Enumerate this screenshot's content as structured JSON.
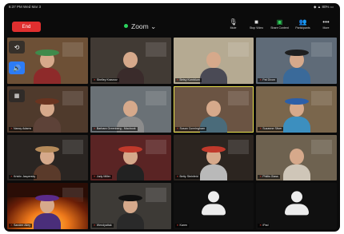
{
  "status_bar": {
    "time": "6:37 PM",
    "date": "Wed Mar 3",
    "battery": "80%"
  },
  "meeting": {
    "end_label": "End",
    "title": "Zoom"
  },
  "toolbar": [
    {
      "label": "Mute",
      "icon": "microphone-icon"
    },
    {
      "label": "Stop Video",
      "icon": "video-camera-icon"
    },
    {
      "label": "Share Content",
      "icon": "share-screen-icon"
    },
    {
      "label": "Participants",
      "icon": "participants-icon"
    },
    {
      "label": "More",
      "icon": "more-icon"
    }
  ],
  "participants": [
    {
      "name": "",
      "bg": "#6d5036",
      "shirt": "#8e2a2a",
      "hat": "#3f8a4b",
      "self": true
    },
    {
      "name": "Shelley Krasnov",
      "bg": "#413a34",
      "shirt": "#3a2b2b",
      "hat": ""
    },
    {
      "name": "Betsy Kornblum",
      "bg": "#b5aa92",
      "shirt": "#4a4a55",
      "hat": ""
    },
    {
      "name": "Pat Dixon",
      "bg": "#5f6b78",
      "shirt": "#3a6a9a",
      "hat": "#1f1f1f"
    },
    {
      "name": "Nancy Adams",
      "bg": "#4f3a2c",
      "shirt": "#5d4238",
      "hat": "#6a3420"
    },
    {
      "name": "Barbara Greenberg - Macbook",
      "bg": "#6a7176",
      "shirt": "#8c8c8c",
      "hat": ""
    },
    {
      "name": "Susan Cunningham",
      "bg": "#6b5443",
      "shirt": "#4a6b7a",
      "hat": "",
      "active": true
    },
    {
      "name": "Suzanne Silver",
      "bg": "#7a664c",
      "shirt": "#3c8fbf",
      "hat": "#2c5fa8"
    },
    {
      "name": "Kristin Jaspersky",
      "bg": "#2a2522",
      "shirt": "#5a3a2a",
      "hat": "#b58a5a"
    },
    {
      "name": "Judy Miller",
      "bg": "#5a2424",
      "shirt": "#222",
      "hat": "#c0392b"
    },
    {
      "name": "Betty Steinfeld",
      "bg": "#2c2520",
      "shirt": "#b9b9b9",
      "hat": "#c0392b"
    },
    {
      "name": "Phillis Glass",
      "bg": "#6e6250",
      "shirt": "#cfc6b8",
      "hat": ""
    },
    {
      "name": "Sandee Ailey",
      "bg": "#2a0d06",
      "shirt": "#4a2e7a",
      "hat": "#5b2b8a",
      "fire": true
    },
    {
      "name": "Wendyattak",
      "bg": "#3d3a36",
      "shirt": "#2a2a2a",
      "hat": "#111"
    },
    {
      "name": "Karen",
      "bg": "#101010",
      "avatar": true
    },
    {
      "name": "iPad",
      "bg": "#101010",
      "avatar": true
    }
  ]
}
